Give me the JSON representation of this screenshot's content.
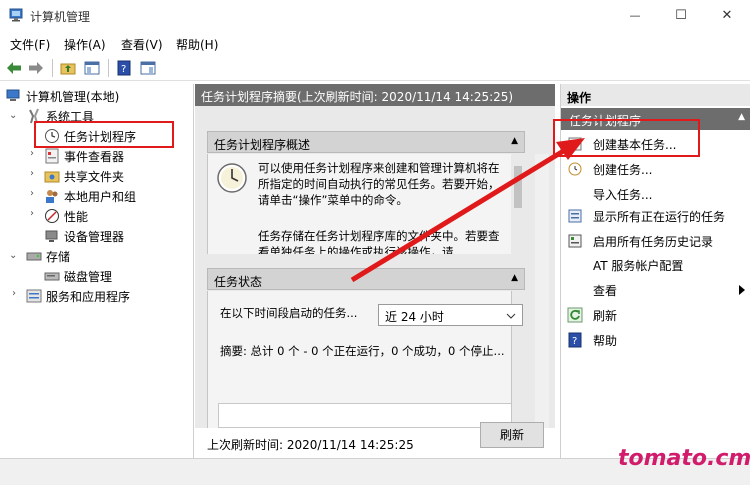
{
  "window": {
    "title": "计算机管理",
    "minimize": "—",
    "maximize": "☐",
    "close": "✕"
  },
  "menubar": [
    "文件(F)",
    "操作(A)",
    "查看(V)",
    "帮助(H)"
  ],
  "tree": {
    "root": "计算机管理(本地)",
    "system_tools": "系统工具",
    "task_scheduler": "任务计划程序",
    "event_viewer": "事件查看器",
    "shared_folders": "共享文件夹",
    "local_users": "本地用户和组",
    "performance": "性能",
    "device_manager": "设备管理器",
    "storage": "存储",
    "disk_management": "磁盘管理",
    "services_apps": "服务和应用程序"
  },
  "middle": {
    "header": "任务计划程序摘要(上次刷新时间: 2020/11/14 14:25:25)",
    "overview_title": "任务计划程序概述",
    "overview_text_1": "可以使用任务计划程序来创建和管理计算机将在所指定的时间自动执行的常见任务。若要开始，请单击“操作”菜单中的命令。",
    "overview_text_2": "任务存储在任务计划程序库的文件夹中。若要查看单独任务上的操作或执行该操作，请",
    "status_title": "任务状态",
    "status_label": "在以下时间段启动的任务...",
    "status_period": "近 24 小时",
    "summary": "摘要: 总计 0 个 - 0 个正在运行，0 个成功，0 个停止...",
    "last_refresh": "上次刷新时间: 2020/11/14 14:25:25",
    "refresh_button": "刷新",
    "collapse_glyph": "▲"
  },
  "actions": {
    "header": "操作",
    "subheader": "任务计划程序",
    "items": [
      "创建基本任务...",
      "创建任务...",
      "导入任务...",
      "显示所有正在运行的任务",
      "启用所有任务历史记录",
      "AT 服务帐户配置",
      "查看",
      "刷新",
      "帮助"
    ]
  },
  "watermark": "tomato.cm",
  "colors": {
    "accent_red": "#e01a1a",
    "header_gray": "#6d6d6d",
    "watermark": "#d11b6b"
  }
}
